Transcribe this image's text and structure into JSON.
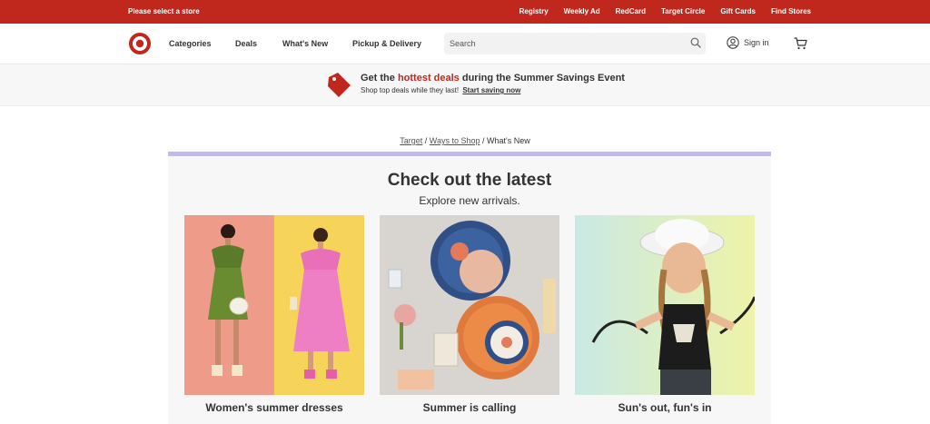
{
  "utility_bar": {
    "store_label": "Please select a store",
    "links": [
      "Registry",
      "Weekly Ad",
      "RedCard",
      "Target Circle",
      "Gift Cards",
      "Find Stores"
    ]
  },
  "header": {
    "nav": [
      "Categories",
      "Deals",
      "What's New",
      "Pickup & Delivery"
    ],
    "search_placeholder": "Search",
    "signin_label": "Sign in"
  },
  "promo": {
    "title_before": "Get the ",
    "title_highlight": "hottest deals",
    "title_after": " during the Summer Savings Event",
    "subtitle": "Shop top deals while they last!",
    "link_label": "Start saving now"
  },
  "breadcrumb": {
    "items": [
      "Target",
      "Ways to Shop",
      "What's New"
    ],
    "separator": " / "
  },
  "main": {
    "headline": "Check out the latest",
    "subheadline": "Explore new arrivals.",
    "cards": [
      {
        "title": "Women's summer dresses"
      },
      {
        "title": "Summer is calling"
      },
      {
        "title": "Sun's out, fun's in"
      }
    ]
  },
  "colors": {
    "brand_red": "#c0281e",
    "accent_lavender": "#c4b8f0"
  },
  "icons": [
    "target-bullseye-logo",
    "search-icon",
    "user-icon",
    "cart-icon",
    "price-tag-icon"
  ]
}
